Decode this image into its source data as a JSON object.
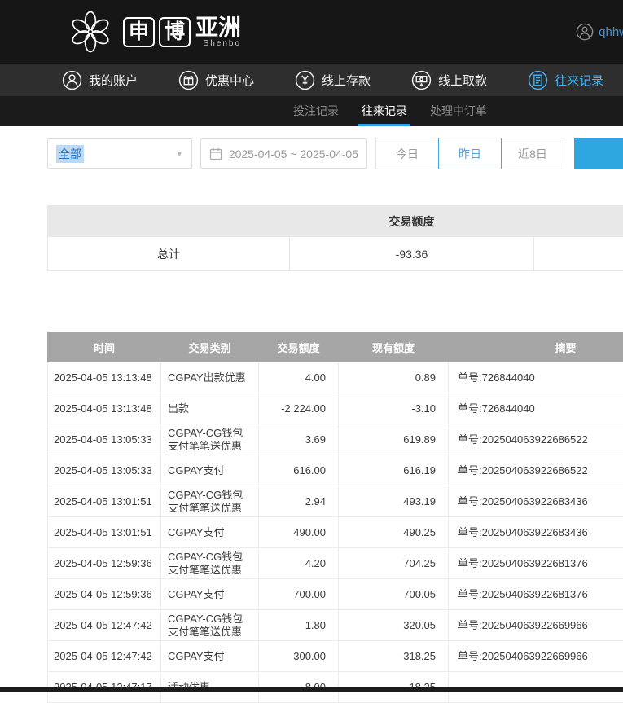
{
  "brand": {
    "char1": "申",
    "char2": "博",
    "name_cn": "亚洲",
    "name_en": "Shenbo"
  },
  "header": {
    "username": "qhhw"
  },
  "nav": {
    "items": [
      {
        "label": "我的账户"
      },
      {
        "label": "优惠中心"
      },
      {
        "label": "线上存款"
      },
      {
        "label": "线上取款"
      },
      {
        "label": "往来记录"
      }
    ]
  },
  "subnav": {
    "items": [
      {
        "label": "投注记录"
      },
      {
        "label": "往来记录"
      },
      {
        "label": "处理中订单"
      }
    ]
  },
  "filters": {
    "type_selected": "全部",
    "date_range": "2025-04-05 ~ 2025-04-05",
    "btn_today": "今日",
    "btn_yesterday": "昨日",
    "btn_last8": "近8日"
  },
  "summary": {
    "title": "交易额度",
    "total_label": "总计",
    "total_value": "-93.36"
  },
  "table": {
    "headers": [
      "时间",
      "交易类别",
      "交易额度",
      "现有额度",
      "摘要"
    ],
    "rows": [
      [
        "2025-04-05 13:13:48",
        "CGPAY出款优惠",
        "4.00",
        "0.89",
        "单号:726844040"
      ],
      [
        "2025-04-05 13:13:48",
        "出款",
        "-2,224.00",
        "-3.10",
        "单号:726844040"
      ],
      [
        "2025-04-05 13:05:33",
        "CGPAY-CG钱包\n支付笔笔送优惠",
        "3.69",
        "619.89",
        "单号:202504063922686522"
      ],
      [
        "2025-04-05 13:05:33",
        "CGPAY支付",
        "616.00",
        "616.19",
        "单号:202504063922686522"
      ],
      [
        "2025-04-05 13:01:51",
        "CGPAY-CG钱包\n支付笔笔送优惠",
        "2.94",
        "493.19",
        "单号:202504063922683436"
      ],
      [
        "2025-04-05 13:01:51",
        "CGPAY支付",
        "490.00",
        "490.25",
        "单号:202504063922683436"
      ],
      [
        "2025-04-05 12:59:36",
        "CGPAY-CG钱包\n支付笔笔送优惠",
        "4.20",
        "704.25",
        "单号:202504063922681376"
      ],
      [
        "2025-04-05 12:59:36",
        "CGPAY支付",
        "700.00",
        "700.05",
        "单号:202504063922681376"
      ],
      [
        "2025-04-05 12:47:42",
        "CGPAY-CG钱包\n支付笔笔送优惠",
        "1.80",
        "320.05",
        "单号:202504063922669966"
      ],
      [
        "2025-04-05 12:47:42",
        "CGPAY支付",
        "300.00",
        "318.25",
        "单号:202504063922669966"
      ],
      [
        "2025-04-05 12:47:17",
        "活动优惠",
        "8.00",
        "18.25",
        ""
      ]
    ]
  },
  "colors": {
    "accent": "#2ea7e0",
    "nav_active": "#3db3f8",
    "header_bg": "#161616",
    "table_header_bg": "#a6a6a6"
  }
}
